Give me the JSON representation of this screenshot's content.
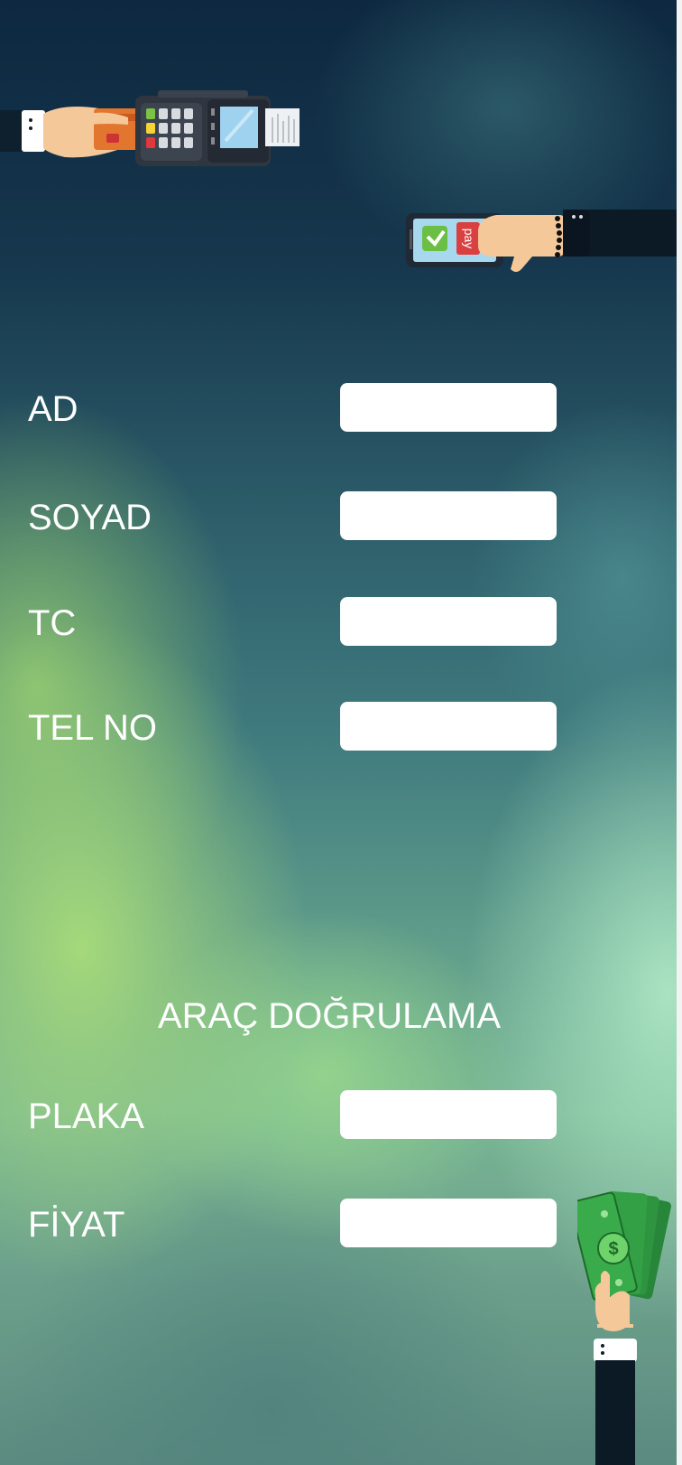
{
  "form": {
    "personal_fields": [
      {
        "label": "AD",
        "value": ""
      },
      {
        "label": "SOYAD",
        "value": ""
      },
      {
        "label": "TC",
        "value": ""
      },
      {
        "label": "TEL NO",
        "value": ""
      }
    ],
    "vehicle_section_title": "ARAÇ DOĞRULAMA",
    "vehicle_fields": [
      {
        "label": "PLAKA",
        "value": ""
      },
      {
        "label": "FİYAT",
        "value": ""
      }
    ]
  },
  "illustrations": {
    "phone_screen_text": "pay"
  },
  "icons": [
    "card-terminal-icon",
    "mobile-pay-icon",
    "cash-hand-icon"
  ]
}
